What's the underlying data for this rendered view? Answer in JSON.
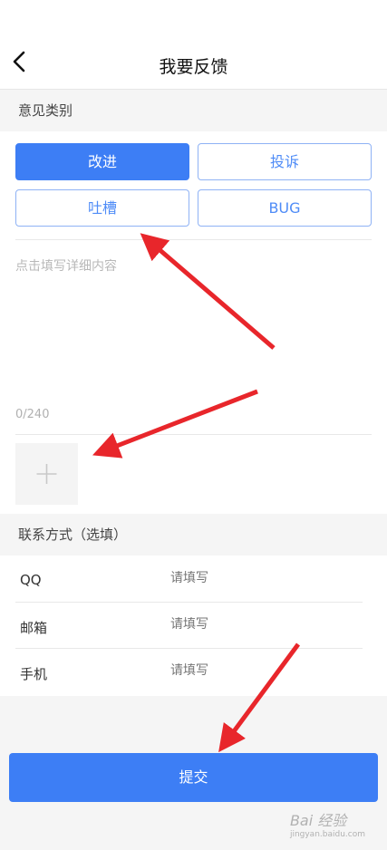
{
  "header": {
    "title": "我要反馈",
    "back_icon": "chevron-left-icon"
  },
  "category": {
    "label": "意见类别",
    "options": [
      {
        "label": "改进",
        "selected": true
      },
      {
        "label": "投诉",
        "selected": false
      },
      {
        "label": "吐槽",
        "selected": false
      },
      {
        "label": "BUG",
        "selected": false
      }
    ]
  },
  "detail": {
    "placeholder": "点击填写详细内容",
    "counter": "0/240"
  },
  "upload": {
    "icon": "plus-icon"
  },
  "contact": {
    "label": "联系方式（选填）",
    "rows": [
      {
        "label": "QQ",
        "placeholder": "请填写"
      },
      {
        "label": "邮箱",
        "placeholder": "请填写"
      },
      {
        "label": "手机",
        "placeholder": "请填写"
      }
    ]
  },
  "submit": {
    "label": "提交"
  },
  "watermark": {
    "text": "Bai 经验",
    "sub": "jingyan.baidu.com"
  },
  "colors": {
    "accent": "#3d7ef5",
    "annotation_arrow": "#e8262b"
  }
}
